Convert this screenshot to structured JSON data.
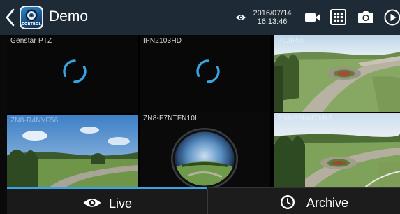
{
  "header": {
    "title": "Demo",
    "logo_text": "CORTROL",
    "date": "2016/07/14",
    "time": "16:13:46"
  },
  "icons": {
    "back": "chevron-left-icon",
    "live_indicator": "eye-icon",
    "record": "video-camera-icon",
    "layout": "grid-icon",
    "snapshot": "camera-icon",
    "play": "play-icon"
  },
  "cameras": [
    {
      "label": "Genstar PTZ",
      "state": "loading"
    },
    {
      "label": "IPN2103HD",
      "state": "loading"
    },
    {
      "label": "PualPro",
      "state": "video"
    },
    {
      "label": "ZN8-R4NVF56",
      "state": "video"
    },
    {
      "label": "ZN8-F7NTFN10L",
      "state": "video"
    },
    {
      "label": "ZN8-F3NMTVRS",
      "state": "video"
    }
  ],
  "tabs": {
    "live": "Live",
    "archive": "Archive",
    "active": "Live"
  },
  "colors": {
    "header_bg": "#1e2a36",
    "accent": "#3aa3e3",
    "tab_bg": "#1a1a1a"
  }
}
